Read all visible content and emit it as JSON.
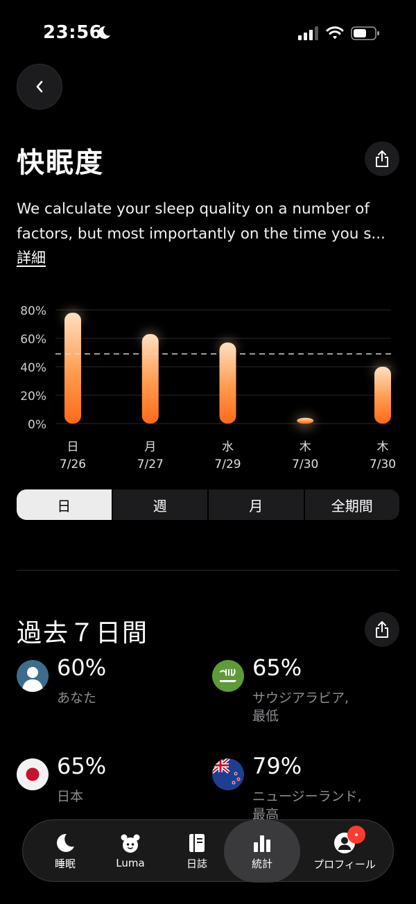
{
  "status": {
    "time": "23:56"
  },
  "page": {
    "title": "快眠度",
    "description_line1": "We calculate your sleep quality on a number of",
    "description_line2": "factors, but most importantly on the time you s...",
    "details_link": "詳細"
  },
  "chart_data": {
    "type": "bar",
    "categories": [
      "日 7/26",
      "月 7/27",
      "水 7/29",
      "木 7/30",
      "木 7/30"
    ],
    "weekday_labels": [
      "日",
      "月",
      "水",
      "木",
      "木"
    ],
    "date_labels": [
      "7/26",
      "7/27",
      "7/29",
      "7/30",
      "7/30"
    ],
    "values": [
      78,
      63,
      57,
      4,
      40
    ],
    "average_line": 49,
    "y_ticks": [
      "80%",
      "60%",
      "40%",
      "20%",
      "0%"
    ],
    "ylim": [
      0,
      80
    ],
    "grid": true,
    "colors": {
      "top": "#ffd9b0",
      "bottom": "#ff6a1a"
    }
  },
  "range_selector": {
    "options": [
      "日",
      "週",
      "月",
      "全期間"
    ],
    "selected": "日"
  },
  "comparison": {
    "title": "過去７日間",
    "items": [
      {
        "value": "60%",
        "label": "あなた",
        "icon": "user-avatar-icon"
      },
      {
        "value": "65%",
        "label": "サウジアラビア,\n最低",
        "icon": "saudi-flag-icon"
      },
      {
        "value": "65%",
        "label": "日本",
        "icon": "japan-flag-icon"
      },
      {
        "value": "79%",
        "label": "ニュージーランド,\n最高",
        "icon": "new-zealand-flag-icon"
      }
    ]
  },
  "tabbar": {
    "tabs": [
      {
        "label": "睡眠",
        "icon": "moon-icon"
      },
      {
        "label": "Luma",
        "icon": "alarm-clock-icon"
      },
      {
        "label": "日誌",
        "icon": "journal-icon"
      },
      {
        "label": "統計",
        "icon": "bar-chart-icon"
      },
      {
        "label": "プロフィール",
        "icon": "profile-icon"
      }
    ],
    "active": "統計"
  },
  "colors": {
    "accent": "#ff6a1a",
    "badge": "#ff3b30"
  }
}
